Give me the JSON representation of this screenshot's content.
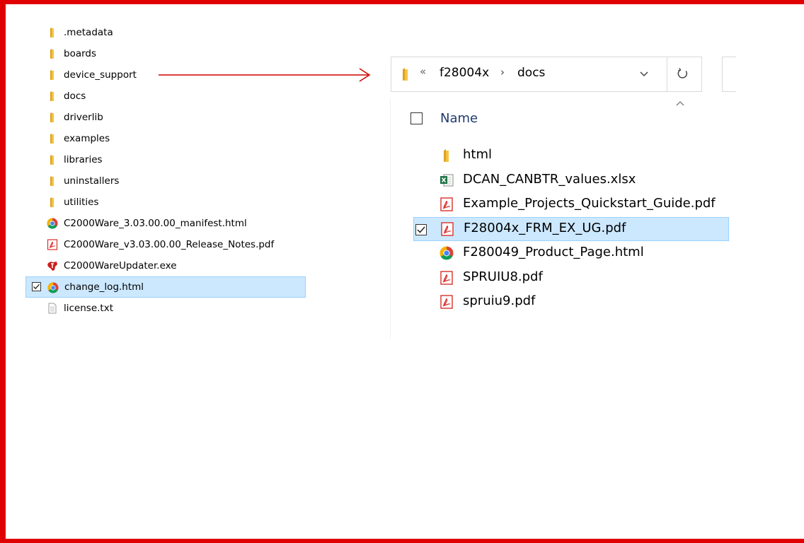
{
  "left_pane": {
    "items": [
      {
        "name": ".metadata",
        "icon": "folder-icon"
      },
      {
        "name": "boards",
        "icon": "folder-icon"
      },
      {
        "name": "device_support",
        "icon": "folder-icon"
      },
      {
        "name": "docs",
        "icon": "folder-icon"
      },
      {
        "name": "driverlib",
        "icon": "folder-icon"
      },
      {
        "name": "examples",
        "icon": "folder-icon"
      },
      {
        "name": "libraries",
        "icon": "folder-icon"
      },
      {
        "name": "uninstallers",
        "icon": "folder-icon"
      },
      {
        "name": "utilities",
        "icon": "folder-icon"
      },
      {
        "name": "C2000Ware_3.03.00.00_manifest.html",
        "icon": "chrome-icon"
      },
      {
        "name": "C2000Ware_v3.03.00.00_Release_Notes.pdf",
        "icon": "pdf-icon"
      },
      {
        "name": "C2000WareUpdater.exe",
        "icon": "ti-logo-icon"
      },
      {
        "name": "change_log.html",
        "icon": "chrome-icon",
        "selected": true
      },
      {
        "name": "license.txt",
        "icon": "text-file-icon"
      }
    ]
  },
  "explorer": {
    "address": {
      "overflow_chevron": "«",
      "separator": "›",
      "crumbs": [
        "f28004x",
        "docs"
      ]
    },
    "column_header": "Name",
    "files": [
      {
        "name": "html",
        "icon": "folder-icon"
      },
      {
        "name": "DCAN_CANBTR_values.xlsx",
        "icon": "excel-icon"
      },
      {
        "name": "Example_Projects_Quickstart_Guide.pdf",
        "icon": "pdf-icon"
      },
      {
        "name": "F28004x_FRM_EX_UG.pdf",
        "icon": "pdf-icon",
        "selected": true
      },
      {
        "name": "F280049_Product_Page.html",
        "icon": "chrome-icon"
      },
      {
        "name": "SPRUIU8.pdf",
        "icon": "pdf-icon"
      },
      {
        "name": "spruiu9.pdf",
        "icon": "pdf-icon"
      }
    ]
  },
  "colors": {
    "frame_border": "#e00000",
    "arrow": "#d00000",
    "selection_fill": "#cce8ff",
    "selection_border": "#99d1ff",
    "folder": "#f5c342",
    "pdf": "#d9312b",
    "excel": "#1f7244"
  }
}
